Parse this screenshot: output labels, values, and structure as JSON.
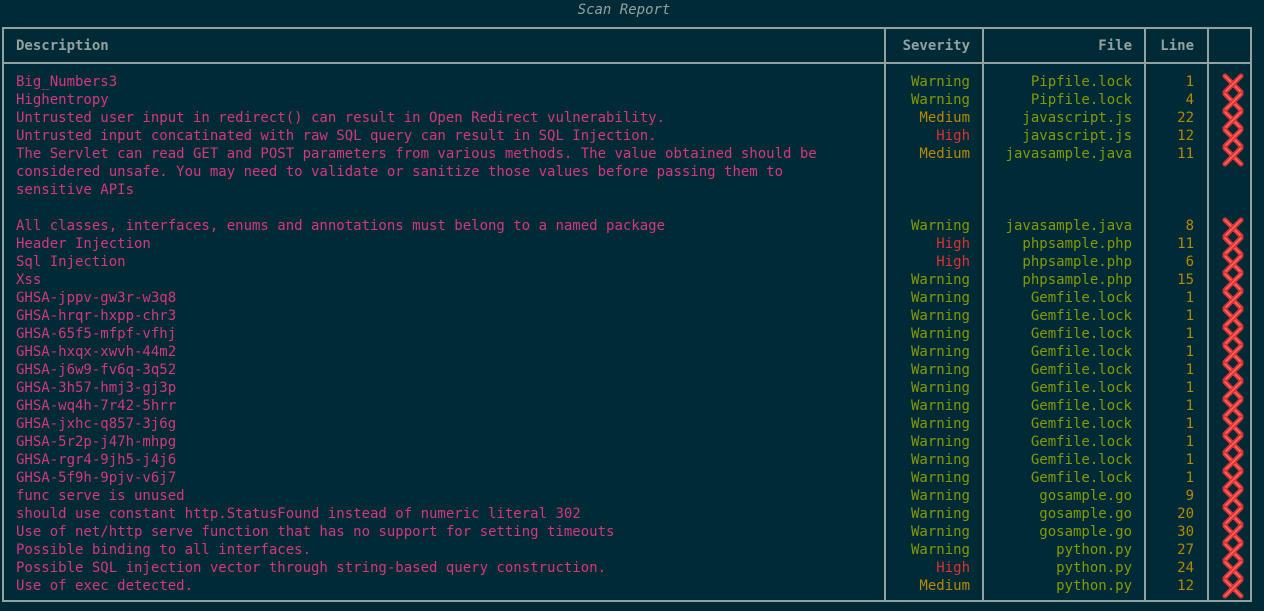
{
  "title": "Scan Report",
  "headers": {
    "description": "Description",
    "severity": "Severity",
    "file": "File",
    "line": "Line"
  },
  "colors": {
    "background": "#002b36",
    "border": "#93a1a1",
    "description": "#d33682",
    "warning": "#859900",
    "medium": "#b58900",
    "high": "#dc322f",
    "file": "#859900",
    "line": "#b58900",
    "fail_icon": "#dc322f"
  },
  "rows": [
    {
      "description": "Big_Numbers3",
      "severity": "Warning",
      "file": "Pipfile.lock",
      "line": "1",
      "status_icon": "fail-x-icon"
    },
    {
      "description": "Highentropy",
      "severity": "Warning",
      "file": "Pipfile.lock",
      "line": "4",
      "status_icon": "fail-x-icon"
    },
    {
      "description": "Untrusted user input in redirect() can result in Open Redirect vulnerability.",
      "severity": "Medium",
      "file": "javascript.js",
      "line": "22",
      "status_icon": "fail-x-icon"
    },
    {
      "description": "Untrusted input concatinated with raw SQL query can result in SQL Injection.",
      "severity": "High",
      "file": "javascript.js",
      "line": "12",
      "status_icon": "fail-x-icon"
    },
    {
      "description": "The Servlet can read GET and POST parameters from various methods. The value obtained should be\nconsidered unsafe. You may need to validate or sanitize those values before passing them to\nsensitive APIs\n",
      "severity": "Medium",
      "file": "javasample.java",
      "line": "11",
      "status_icon": "fail-x-icon"
    },
    {
      "description": "All classes, interfaces, enums and annotations must belong to a named package",
      "severity": "Warning",
      "file": "javasample.java",
      "line": "8",
      "status_icon": "fail-x-icon"
    },
    {
      "description": "Header Injection",
      "severity": "High",
      "file": "phpsample.php",
      "line": "11",
      "status_icon": "fail-x-icon"
    },
    {
      "description": "Sql Injection",
      "severity": "High",
      "file": "phpsample.php",
      "line": "6",
      "status_icon": "fail-x-icon"
    },
    {
      "description": "Xss",
      "severity": "Warning",
      "file": "phpsample.php",
      "line": "15",
      "status_icon": "fail-x-icon"
    },
    {
      "description": "GHSA-jppv-gw3r-w3q8",
      "severity": "Warning",
      "file": "Gemfile.lock",
      "line": "1",
      "status_icon": "fail-x-icon"
    },
    {
      "description": "GHSA-hrqr-hxpp-chr3",
      "severity": "Warning",
      "file": "Gemfile.lock",
      "line": "1",
      "status_icon": "fail-x-icon"
    },
    {
      "description": "GHSA-65f5-mfpf-vfhj",
      "severity": "Warning",
      "file": "Gemfile.lock",
      "line": "1",
      "status_icon": "fail-x-icon"
    },
    {
      "description": "GHSA-hxqx-xwvh-44m2",
      "severity": "Warning",
      "file": "Gemfile.lock",
      "line": "1",
      "status_icon": "fail-x-icon"
    },
    {
      "description": "GHSA-j6w9-fv6q-3q52",
      "severity": "Warning",
      "file": "Gemfile.lock",
      "line": "1",
      "status_icon": "fail-x-icon"
    },
    {
      "description": "GHSA-3h57-hmj3-gj3p",
      "severity": "Warning",
      "file": "Gemfile.lock",
      "line": "1",
      "status_icon": "fail-x-icon"
    },
    {
      "description": "GHSA-wq4h-7r42-5hrr",
      "severity": "Warning",
      "file": "Gemfile.lock",
      "line": "1",
      "status_icon": "fail-x-icon"
    },
    {
      "description": "GHSA-jxhc-q857-3j6g",
      "severity": "Warning",
      "file": "Gemfile.lock",
      "line": "1",
      "status_icon": "fail-x-icon"
    },
    {
      "description": "GHSA-5r2p-j47h-mhpg",
      "severity": "Warning",
      "file": "Gemfile.lock",
      "line": "1",
      "status_icon": "fail-x-icon"
    },
    {
      "description": "GHSA-rgr4-9jh5-j4j6",
      "severity": "Warning",
      "file": "Gemfile.lock",
      "line": "1",
      "status_icon": "fail-x-icon"
    },
    {
      "description": "GHSA-5f9h-9pjv-v6j7",
      "severity": "Warning",
      "file": "Gemfile.lock",
      "line": "1",
      "status_icon": "fail-x-icon"
    },
    {
      "description": "func serve is unused",
      "severity": "Warning",
      "file": "gosample.go",
      "line": "9",
      "status_icon": "fail-x-icon"
    },
    {
      "description": "should use constant http.StatusFound instead of numeric literal 302",
      "severity": "Warning",
      "file": "gosample.go",
      "line": "20",
      "status_icon": "fail-x-icon"
    },
    {
      "description": "Use of net/http serve function that has no support for setting timeouts",
      "severity": "Warning",
      "file": "gosample.go",
      "line": "30",
      "status_icon": "fail-x-icon"
    },
    {
      "description": "Possible binding to all interfaces.",
      "severity": "Warning",
      "file": "python.py",
      "line": "27",
      "status_icon": "fail-x-icon"
    },
    {
      "description": "Possible SQL injection vector through string-based query construction.",
      "severity": "High",
      "file": "python.py",
      "line": "24",
      "status_icon": "fail-x-icon"
    },
    {
      "description": "Use of exec detected.",
      "severity": "Medium",
      "file": "python.py",
      "line": "12",
      "status_icon": "fail-x-icon"
    }
  ]
}
